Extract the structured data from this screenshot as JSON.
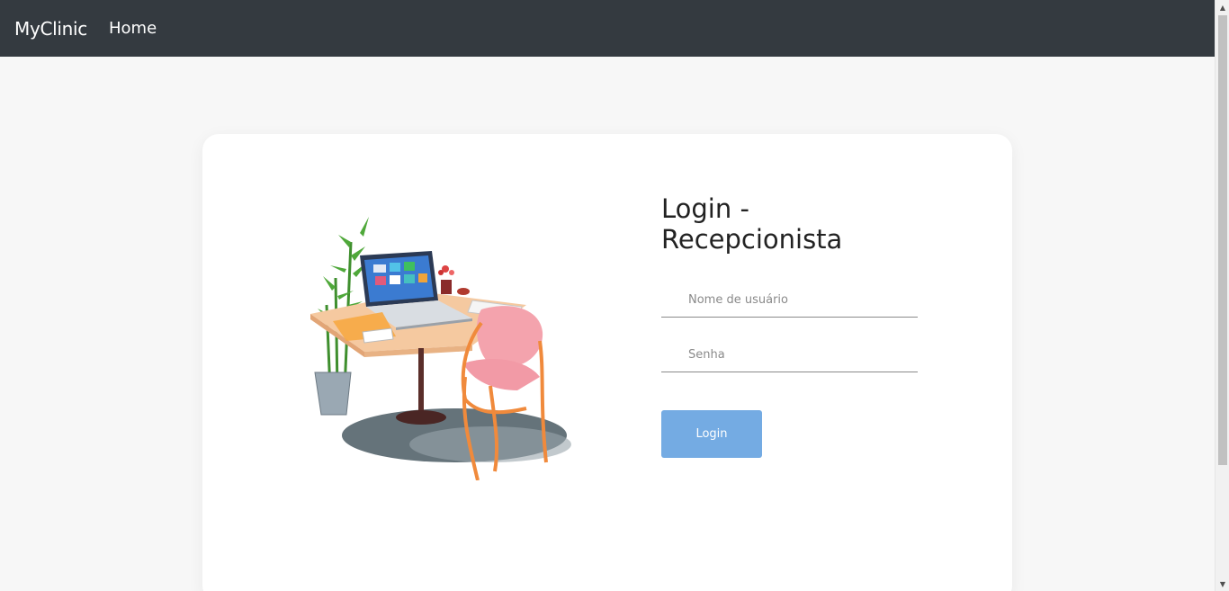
{
  "navbar": {
    "brand": "MyClinic",
    "links": [
      {
        "label": "Home"
      }
    ]
  },
  "login": {
    "title": "Login - Recepcionista",
    "username": {
      "placeholder": "Nome de usuário",
      "value": ""
    },
    "password": {
      "placeholder": "Senha",
      "value": ""
    },
    "submit_label": "Login"
  },
  "colors": {
    "navbar_bg": "#343a40",
    "page_bg": "#f7f7f7",
    "button_bg": "#74abe3"
  },
  "illustration": {
    "icon": "desk-workspace-illustration"
  }
}
